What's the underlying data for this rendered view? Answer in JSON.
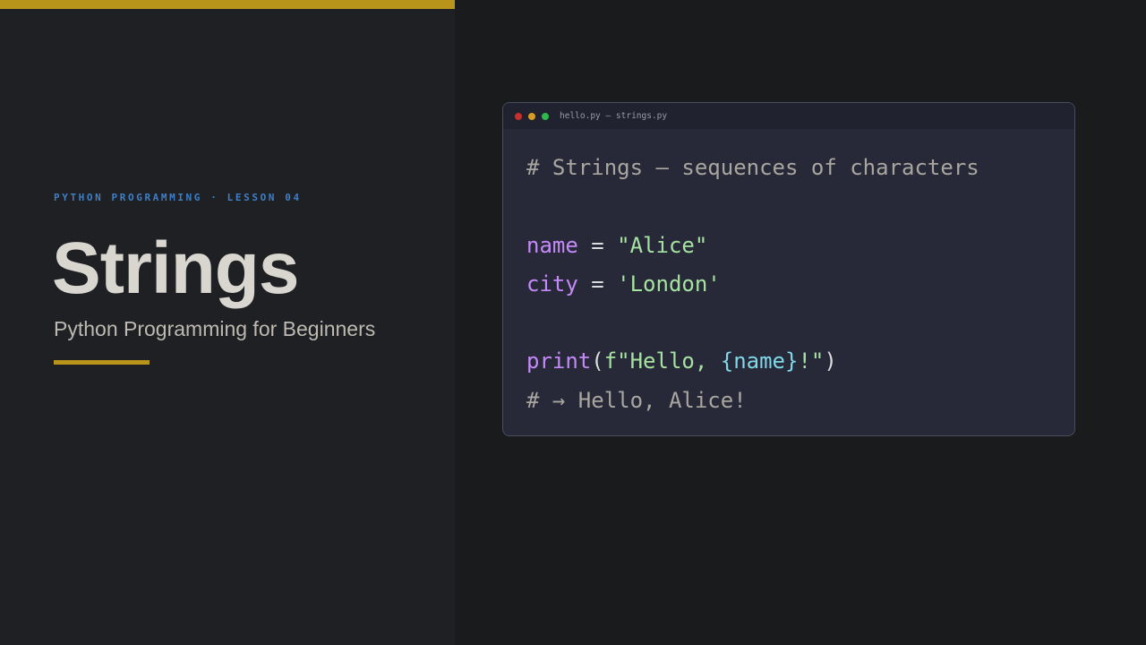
{
  "colors": {
    "accent": "#b8941a",
    "eyebrow": "#3d7fc9",
    "title": "#d9d6cf",
    "subtitle": "#bdbab2",
    "window_bg": "#272838",
    "titlebar_bg": "#21222f",
    "filename": "#9a9aa6",
    "dot_red": "#c9302c",
    "dot_yellow": "#d89b22",
    "dot_green": "#2eb84b",
    "code_comment": "#a9a6a0",
    "code_variable": "#c58af9",
    "code_operator": "#dcdcdc",
    "code_string": "#a6e3a1",
    "code_function": "#c58af9",
    "code_paren": "#dcdcdc",
    "code_interp": "#80d8e8"
  },
  "slide": {
    "eyebrow": "PYTHON PROGRAMMING · LESSON 04",
    "title": "Strings",
    "subtitle": "Python Programming for Beginners"
  },
  "editor": {
    "filename": "hello.py — strings.py",
    "code": {
      "line1": "# Strings — sequences of characters",
      "line3_var": "name",
      "line3_op": " = ",
      "line3_str": "\"Alice\"",
      "line4_var": "city",
      "line4_op": " = ",
      "line4_str": "'London'",
      "line6_func": "print",
      "line6_open": "(",
      "line6_fstart": "f\"Hello, ",
      "line6_interp": "{name}",
      "line6_fend": "!\"",
      "line6_close": ")",
      "line7": "# → Hello, Alice!"
    }
  }
}
